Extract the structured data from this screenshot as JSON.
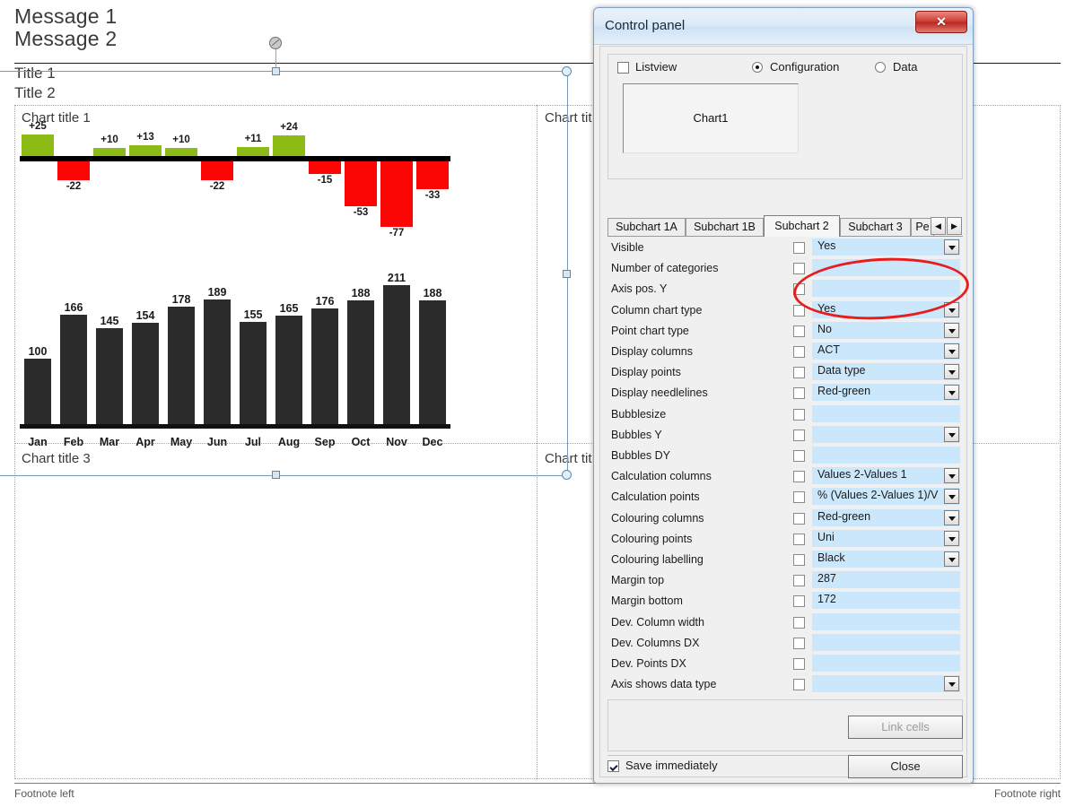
{
  "canvas": {
    "messages": [
      "Message 1",
      "Message 2"
    ],
    "title1": "Title 1",
    "title2": "Title 2",
    "chart_titles": {
      "top_left": "Chart title 1",
      "top_right": "Chart tit",
      "bottom_left": "Chart title 3",
      "bottom_right": "Chart tit"
    },
    "footnote_left": "Footnote left",
    "footnote_right": "Footnote right"
  },
  "chart_data": [
    {
      "type": "bar",
      "title": "Chart title 1",
      "categories": [
        "Jan",
        "Feb",
        "Mar",
        "Apr",
        "May",
        "Jun",
        "Jul",
        "Aug",
        "Sep",
        "Oct",
        "Nov",
        "Dec"
      ],
      "values": [
        25,
        -22,
        10,
        13,
        10,
        -22,
        11,
        24,
        -15,
        -53,
        -77,
        -33
      ],
      "labels": [
        "+25",
        "-22",
        "+10",
        "+13",
        "+10",
        "-22",
        "+11",
        "+24",
        "-15",
        "-53",
        "-77",
        "-33"
      ],
      "positive_color": "#8CBB16",
      "negative_color": "#FB0505",
      "axis_color": "#000000",
      "xlabel": "",
      "ylabel": "",
      "ylim": [
        -80,
        30
      ],
      "grid": false,
      "legend": "none"
    },
    {
      "type": "bar",
      "title": "",
      "categories": [
        "Jan",
        "Feb",
        "Mar",
        "Apr",
        "May",
        "Jun",
        "Jul",
        "Aug",
        "Sep",
        "Oct",
        "Nov",
        "Dec"
      ],
      "values": [
        100,
        166,
        145,
        154,
        178,
        189,
        155,
        165,
        176,
        188,
        211,
        188
      ],
      "bar_color": "#2B2B2B",
      "xlabel": "",
      "ylabel": "",
      "ylim": [
        0,
        211
      ],
      "grid": false,
      "legend": "none"
    }
  ],
  "dialog": {
    "title": "Control panel",
    "close_glyph": "✕",
    "listview_label": "Listview",
    "listview_checked": false,
    "mode_options": [
      {
        "label": "Configuration",
        "selected": true
      },
      {
        "label": "Data",
        "selected": false
      }
    ],
    "listbox_item": "Chart1",
    "tabs": [
      {
        "label": "Subchart 1A",
        "active": false
      },
      {
        "label": "Subchart 1B",
        "active": false
      },
      {
        "label": "Subchart 2",
        "active": true
      },
      {
        "label": "Subchart 3",
        "active": false
      },
      {
        "label": "Pe",
        "active": false
      }
    ],
    "tab_scroll_left": "◀",
    "tab_scroll_right": "▶",
    "properties": [
      {
        "name": "Visible",
        "checked": false,
        "value": "Yes",
        "dropdown": true
      },
      {
        "name": "Number of categories",
        "checked": false,
        "value": "",
        "dropdown": false
      },
      {
        "name": "Axis pos. Y",
        "checked": false,
        "value": "",
        "dropdown": false
      },
      {
        "name": "Column chart type",
        "checked": false,
        "value": "Yes",
        "dropdown": true
      },
      {
        "name": "Point chart type",
        "checked": false,
        "value": "No",
        "dropdown": true
      },
      {
        "name": "Display columns",
        "checked": false,
        "value": "ACT",
        "dropdown": true
      },
      {
        "name": "Display points",
        "checked": false,
        "value": "Data type",
        "dropdown": true
      },
      {
        "name": "Display needlelines",
        "checked": false,
        "value": "Red-green",
        "dropdown": true
      },
      {
        "name": "Bubblesize",
        "checked": false,
        "value": "",
        "dropdown": false
      },
      {
        "name": "Bubbles Y",
        "checked": false,
        "value": "",
        "dropdown": true
      },
      {
        "name": "Bubbles DY",
        "checked": false,
        "value": "",
        "dropdown": false
      },
      {
        "name": "Calculation columns",
        "checked": false,
        "value": "Values  2-Values  1",
        "dropdown": true
      },
      {
        "name": "Calculation points",
        "checked": false,
        "value": "% (Values 2-Values 1)/V",
        "dropdown": true
      },
      {
        "name": "Colouring columns",
        "checked": false,
        "value": "Red-green",
        "dropdown": true
      },
      {
        "name": "Colouring points",
        "checked": false,
        "value": "Uni",
        "dropdown": true
      },
      {
        "name": "Colouring labelling",
        "checked": false,
        "value": "Black",
        "dropdown": true
      },
      {
        "name": "Margin top",
        "checked": false,
        "value": "287",
        "dropdown": false
      },
      {
        "name": "Margin bottom",
        "checked": false,
        "value": "172",
        "dropdown": false
      },
      {
        "name": "Dev. Column width",
        "checked": false,
        "value": "",
        "dropdown": false
      },
      {
        "name": "Dev. Columns DX",
        "checked": false,
        "value": "",
        "dropdown": false
      },
      {
        "name": "Dev. Points DX",
        "checked": false,
        "value": "",
        "dropdown": false
      },
      {
        "name": "Axis shows data type",
        "checked": false,
        "value": "",
        "dropdown": true
      }
    ],
    "link_cells_label": "Link cells",
    "link_cells_enabled": false,
    "save_immediately_label": "Save immediately",
    "save_immediately_checked": true,
    "close_label": "Close"
  },
  "annotation": {
    "shape": "ellipse",
    "color": "#E81C1C"
  }
}
